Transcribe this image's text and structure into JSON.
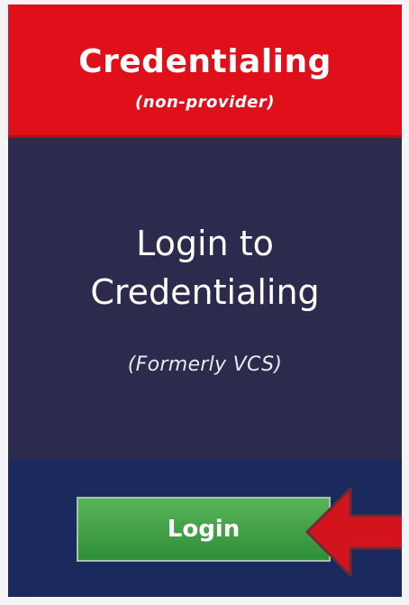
{
  "header": {
    "title": "Credentialing",
    "subtitle": "(non-provider)"
  },
  "main": {
    "title_line1": "Login to",
    "title_line2": "Credentialing",
    "subtitle": "(Formerly VCS)"
  },
  "footer": {
    "login_label": "Login"
  },
  "colors": {
    "header_red": "#e0101b",
    "panel_navy": "#2c2a4d",
    "footer_navy": "#1b2a5e",
    "button_green": "#3a9d3f",
    "arrow_red": "#d4141c"
  },
  "icons": {
    "pointer": "left-arrow-icon"
  }
}
